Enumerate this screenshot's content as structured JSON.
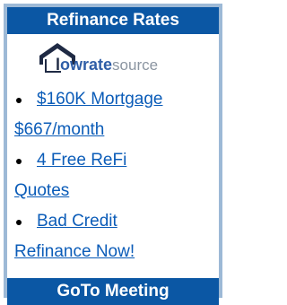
{
  "top_header": "Refinance Rates",
  "logo_text": {
    "l": "l",
    "owrate": "owrate",
    "source": "source"
  },
  "ads": [
    {
      "line1": "$160K Mortgage",
      "line2": "$667/month"
    },
    {
      "line1": "4 Free ReFi",
      "line2": "Quotes"
    },
    {
      "line1": "Bad Credit",
      "line2": "Refinance Now!"
    }
  ],
  "bottom_header": "GoTo Meeting",
  "colors": {
    "header_bg": "#0b57a4",
    "frame": "#9db9d6",
    "link": "#0b5cb8"
  },
  "icons": {
    "logo": "house-roof-logo-icon"
  }
}
